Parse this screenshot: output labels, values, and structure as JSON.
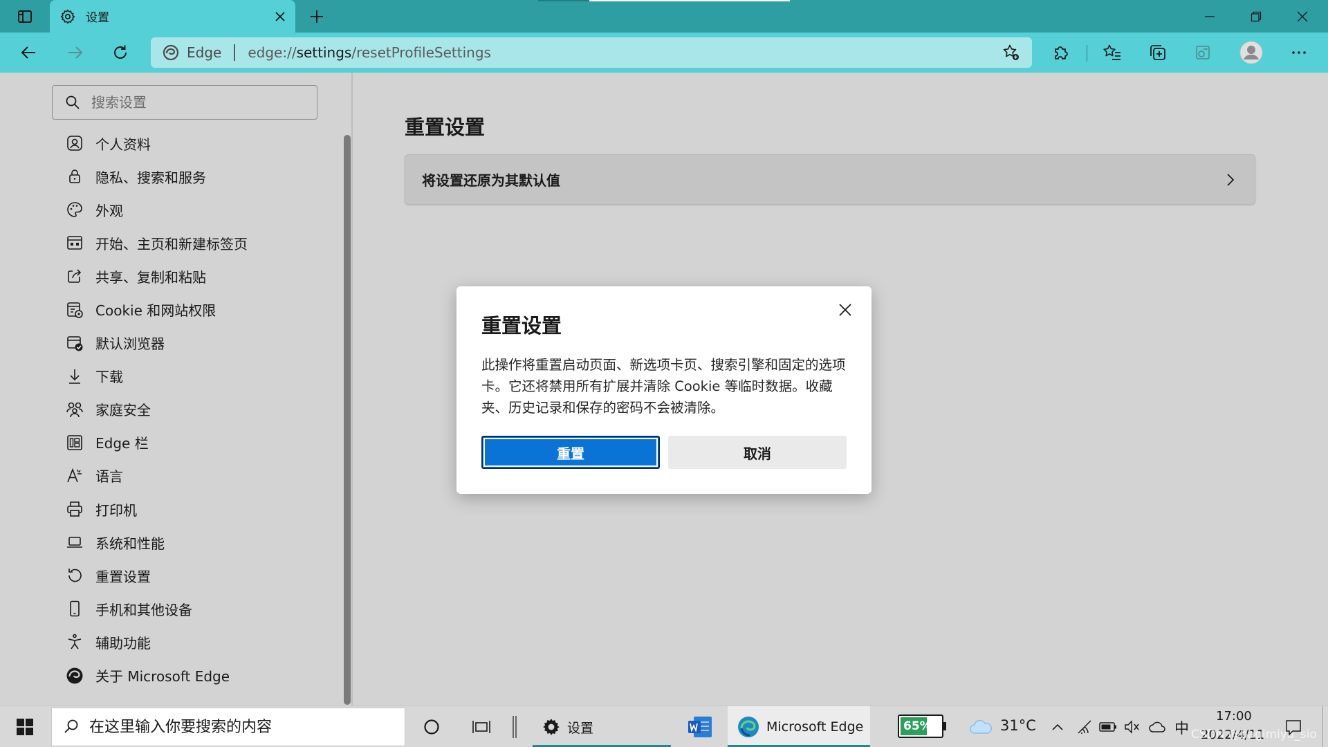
{
  "tabbar": {
    "tab_title": "设置",
    "colors": {
      "bar": "#2e9ea3",
      "active_tab": "#55d0d6",
      "indicator": "#ffffff"
    }
  },
  "toolbar": {
    "site_name": "Edge",
    "url_scheme": "edge://",
    "url_host": "settings",
    "url_path": "/resetProfileSettings"
  },
  "sidebar": {
    "search_placeholder": "搜索设置",
    "items": [
      {
        "label": "个人资料",
        "icon": "profile-icon"
      },
      {
        "label": "隐私、搜索和服务",
        "icon": "lock-icon"
      },
      {
        "label": "外观",
        "icon": "palette-icon"
      },
      {
        "label": "开始、主页和新建标签页",
        "icon": "home-grid-icon"
      },
      {
        "label": "共享、复制和粘贴",
        "icon": "share-icon"
      },
      {
        "label": "Cookie 和网站权限",
        "icon": "cookie-icon"
      },
      {
        "label": "默认浏览器",
        "icon": "default-browser-icon"
      },
      {
        "label": "下载",
        "icon": "download-icon"
      },
      {
        "label": "家庭安全",
        "icon": "family-icon"
      },
      {
        "label": "Edge 栏",
        "icon": "edge-bar-icon"
      },
      {
        "label": "语言",
        "icon": "language-icon"
      },
      {
        "label": "打印机",
        "icon": "printer-icon"
      },
      {
        "label": "系统和性能",
        "icon": "laptop-icon"
      },
      {
        "label": "重置设置",
        "icon": "reset-icon"
      },
      {
        "label": "手机和其他设备",
        "icon": "phone-icon"
      },
      {
        "label": "辅助功能",
        "icon": "accessibility-icon"
      },
      {
        "label": "关于 Microsoft Edge",
        "icon": "edge-logo-icon"
      }
    ]
  },
  "main": {
    "title": "重置设置",
    "card_label": "将设置还原为其默认值"
  },
  "dialog": {
    "title": "重置设置",
    "body": "此操作将重置启动页面、新选项卡页、搜索引擎和固定的选项卡。它还将禁用所有扩展并清除 Cookie 等临时数据。收藏夹、历史记录和保存的密码不会被清除。",
    "confirm_label": "重置",
    "cancel_label": "取消",
    "colors": {
      "confirm_bg": "#0a74d6",
      "cancel_bg": "#eaeaea"
    }
  },
  "taskbar": {
    "search_placeholder": "在这里输入你要搜索的内容",
    "settings_app_label": "设置",
    "edge_app_label": "Microsoft Edge",
    "battery_percent": "65%",
    "battery_level": 0.65,
    "temperature": "31°C",
    "ime": "中",
    "time": "17:00",
    "date": "2022/4/11",
    "watermark": "CSDN @bagimiya_sio",
    "colors": {
      "battery": "#2aa05a"
    }
  }
}
